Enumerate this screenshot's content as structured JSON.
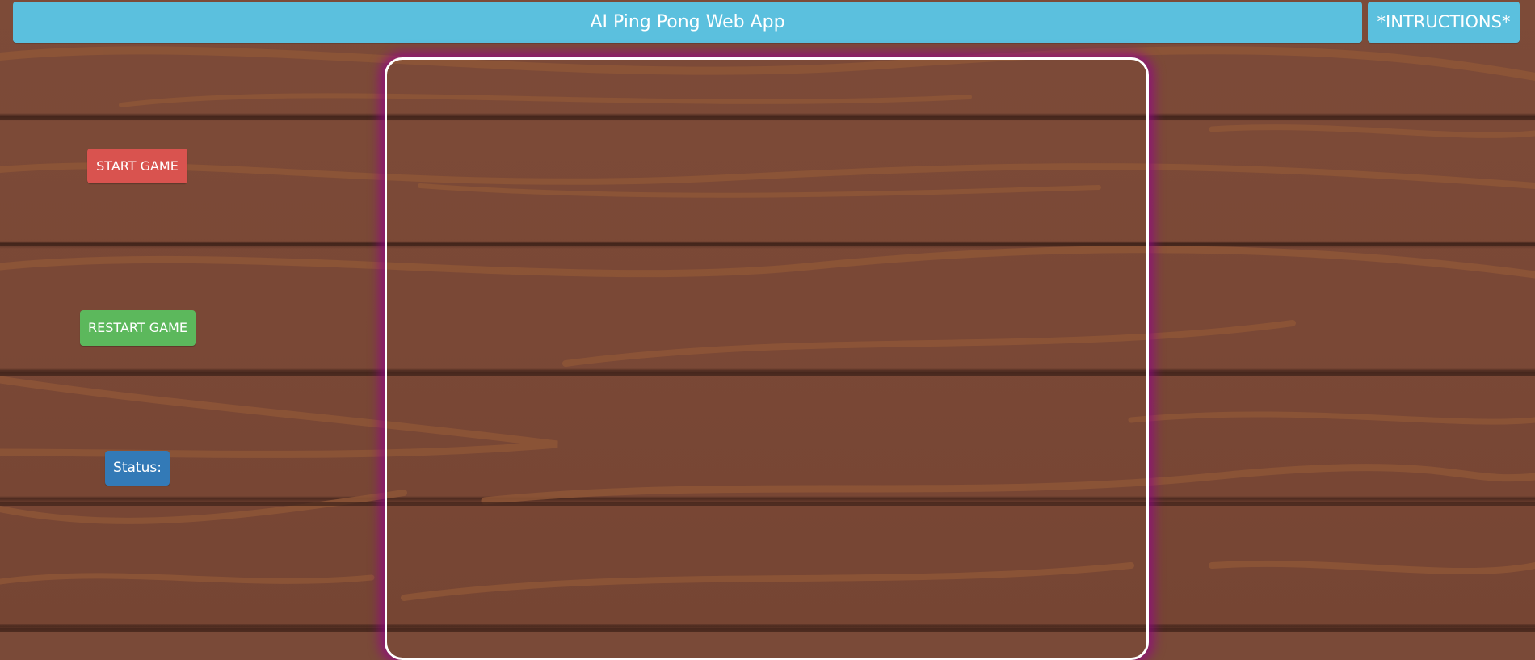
{
  "header": {
    "title": "AI Ping Pong Web App",
    "instructions_label": "*INTRUCTIONS*"
  },
  "controls": {
    "start_label": "START GAME",
    "restart_label": "RESTART GAME",
    "status_label": "Status:"
  },
  "colors": {
    "header_bg": "#5bc0de",
    "start_bg": "#d9534f",
    "restart_bg": "#5cb85c",
    "status_bg": "#337ab7",
    "canvas_border": "#ffffff",
    "canvas_glow": "#96008c",
    "wood": "#7a4a38"
  }
}
